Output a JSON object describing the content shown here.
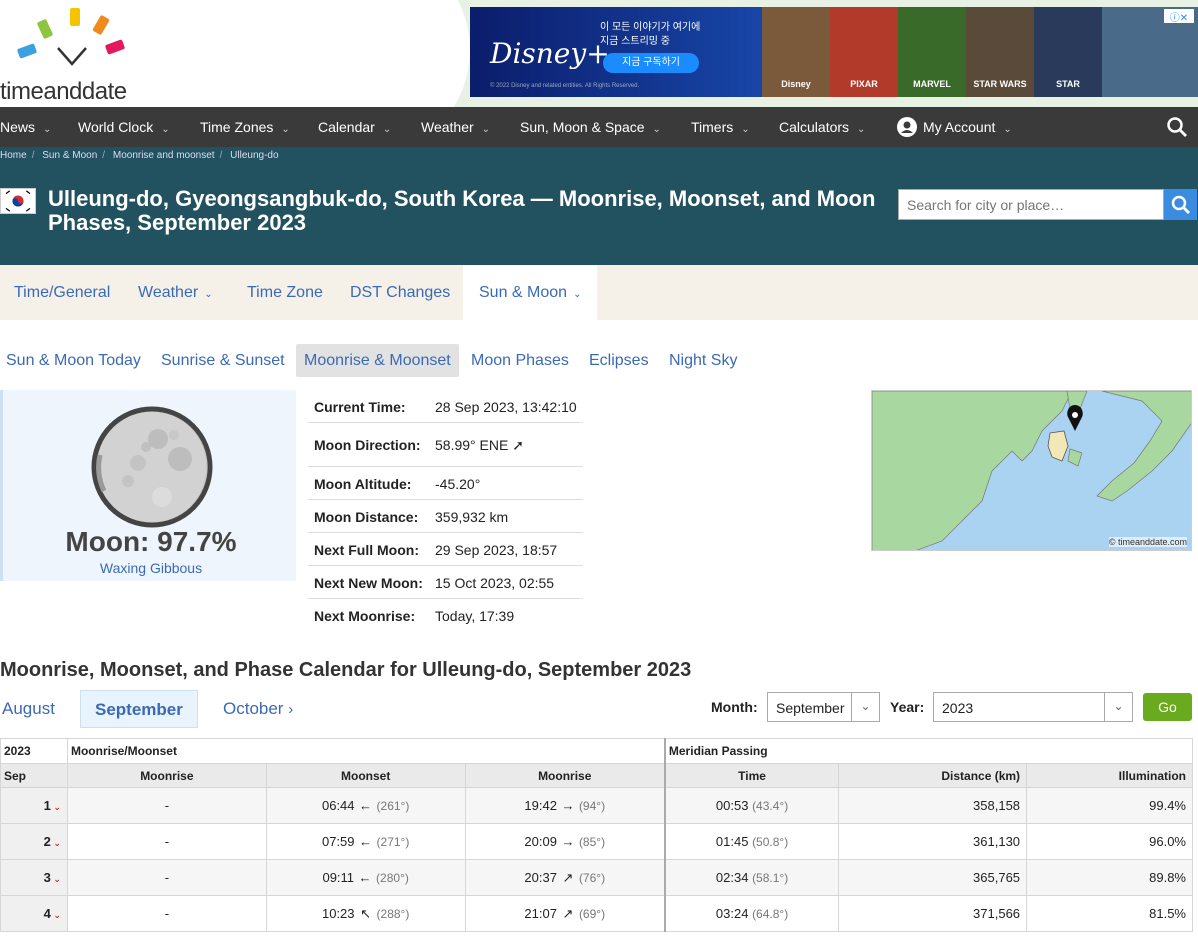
{
  "logo": {
    "text": "timeanddate"
  },
  "ad": {
    "brand": "Disney+",
    "line1": "이 모든 이야기가 여기에",
    "line2": "지금 스트리밍 중",
    "button": "지금 구독하기",
    "fine": "© 2022 Disney and related entities. All Rights Reserved.",
    "tiles": [
      "Disney",
      "PIXAR",
      "MARVEL",
      "STAR WARS",
      "STAR"
    ]
  },
  "nav": {
    "items": [
      "News",
      "World Clock",
      "Time Zones",
      "Calendar",
      "Weather",
      "Sun, Moon & Space",
      "Timers",
      "Calculators",
      "My Account"
    ]
  },
  "breadcrumb": [
    "Home",
    "Sun & Moon",
    "Moonrise and moonset",
    "Ulleung-do"
  ],
  "title": "Ulleung-do, Gyeongsangbuk-do, South Korea — Moonrise, Moonset, and Moon Phases, September 2023",
  "search": {
    "placeholder": "Search for city or place…"
  },
  "tabs": [
    "Time/General",
    "Weather",
    "Time Zone",
    "DST Changes",
    "Sun & Moon"
  ],
  "subnav": [
    "Sun & Moon Today",
    "Sunrise & Sunset",
    "Moonrise & Moonset",
    "Moon Phases",
    "Eclipses",
    "Night Sky"
  ],
  "moon": {
    "label": "Moon: 97.7%",
    "phase": "Waxing Gibbous",
    "illumination": 0.977
  },
  "info": [
    {
      "k": "Current Time:",
      "v": "28 Sep 2023, 13:42:10"
    },
    {
      "k": "Moon Direction:",
      "v": "58.99° ENE ➚"
    },
    {
      "k": "Moon Altitude:",
      "v": "-45.20°"
    },
    {
      "k": "Moon Distance:",
      "v": "359,932 km"
    },
    {
      "k": "Next Full Moon:",
      "v": "29 Sep 2023, 18:57"
    },
    {
      "k": "Next New Moon:",
      "v": "15 Oct 2023, 02:55"
    },
    {
      "k": "Next Moonrise:",
      "v": "Today, 17:39"
    }
  ],
  "map": {
    "copyright": "© timeanddate.com"
  },
  "calendar": {
    "heading": "Moonrise, Moonset, and Phase Calendar for Ulleung-do, September 2023",
    "prev": "August",
    "current": "September",
    "next": "October",
    "month_label": "Month:",
    "month_value": "September",
    "year_label": "Year:",
    "year_value": "2023",
    "go": "Go",
    "hd_year": "2023",
    "hd_group1": "Moonrise/Moonset",
    "hd_group2": "Meridian Passing",
    "cols": [
      "Sep",
      "Moonrise",
      "Moonset",
      "Moonrise",
      "Time",
      "Distance (km)",
      "Illumination"
    ],
    "rows": [
      {
        "day": "1",
        "rise1": "-",
        "set": "06:44",
        "set_arrow": "←",
        "set_deg": "(261°)",
        "rise2": "19:42",
        "rise2_arrow": "→",
        "rise2_deg": "(94°)",
        "mer": "00:53",
        "mer_deg": "(43.4°)",
        "dist": "358,158",
        "illum": "99.4%"
      },
      {
        "day": "2",
        "rise1": "-",
        "set": "07:59",
        "set_arrow": "←",
        "set_deg": "(271°)",
        "rise2": "20:09",
        "rise2_arrow": "→",
        "rise2_deg": "(85°)",
        "mer": "01:45",
        "mer_deg": "(50.8°)",
        "dist": "361,130",
        "illum": "96.0%"
      },
      {
        "day": "3",
        "rise1": "-",
        "set": "09:11",
        "set_arrow": "←",
        "set_deg": "(280°)",
        "rise2": "20:37",
        "rise2_arrow": "↗",
        "rise2_deg": "(76°)",
        "mer": "02:34",
        "mer_deg": "(58.1°)",
        "dist": "365,765",
        "illum": "89.8%"
      },
      {
        "day": "4",
        "rise1": "-",
        "set": "10:23",
        "set_arrow": "↖",
        "set_deg": "(288°)",
        "rise2": "21:07",
        "rise2_arrow": "↗",
        "rise2_deg": "(69°)",
        "mer": "03:24",
        "mer_deg": "(64.8°)",
        "dist": "371,566",
        "illum": "81.5%"
      }
    ]
  }
}
